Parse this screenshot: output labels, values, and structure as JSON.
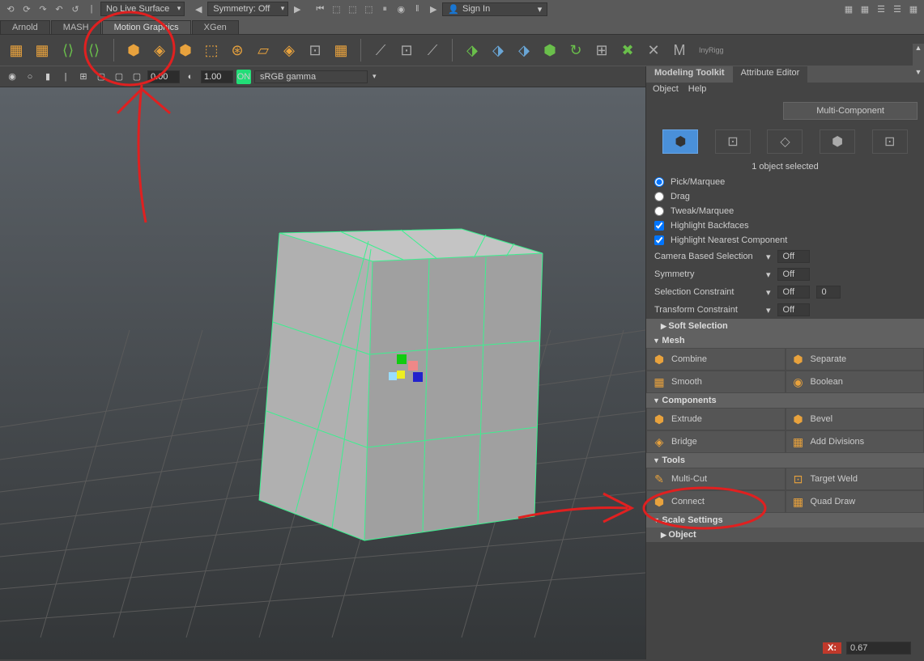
{
  "topbar": {
    "surface_dropdown": "No Live Surface",
    "symmetry": "Symmetry: Off",
    "signin": "Sign In"
  },
  "tabs": [
    "Arnold",
    "MASH",
    "Motion Graphics",
    "XGen"
  ],
  "active_tab": 2,
  "shelf_right_label": "InyRigg",
  "view_toolbar": {
    "val1": "0.00",
    "val2": "1.00",
    "colorspace": "sRGB gamma"
  },
  "right": {
    "tabs": [
      "Modeling Toolkit",
      "Attribute Editor"
    ],
    "menus": [
      "Object",
      "Help"
    ],
    "multi": "Multi-Component",
    "sel_info": "1 object selected",
    "radios": [
      "Pick/Marquee",
      "Drag",
      "Tweak/Marquee"
    ],
    "checks": [
      "Highlight Backfaces",
      "Highlight Nearest Component"
    ],
    "dropdowns": [
      {
        "label": "Camera Based Selection",
        "value": "Off"
      },
      {
        "label": "Symmetry",
        "value": "Off"
      },
      {
        "label": "Selection Constraint",
        "value": "Off",
        "num": "0"
      },
      {
        "label": "Transform Constraint",
        "value": "Off"
      }
    ],
    "sections": {
      "soft": "Soft Selection",
      "mesh": "Mesh",
      "components": "Components",
      "tools": "Tools",
      "scale": "Scale Settings",
      "object": "Object"
    },
    "mesh_tools": [
      "Combine",
      "Separate",
      "Smooth",
      "Boolean"
    ],
    "component_tools": [
      "Extrude",
      "Bevel",
      "Bridge",
      "Add Divisions"
    ],
    "tool_tools": [
      "Multi-Cut",
      "Target Weld",
      "Connect",
      "Quad Draw"
    ],
    "scale_axis": "X:",
    "scale_val": "0.67"
  }
}
